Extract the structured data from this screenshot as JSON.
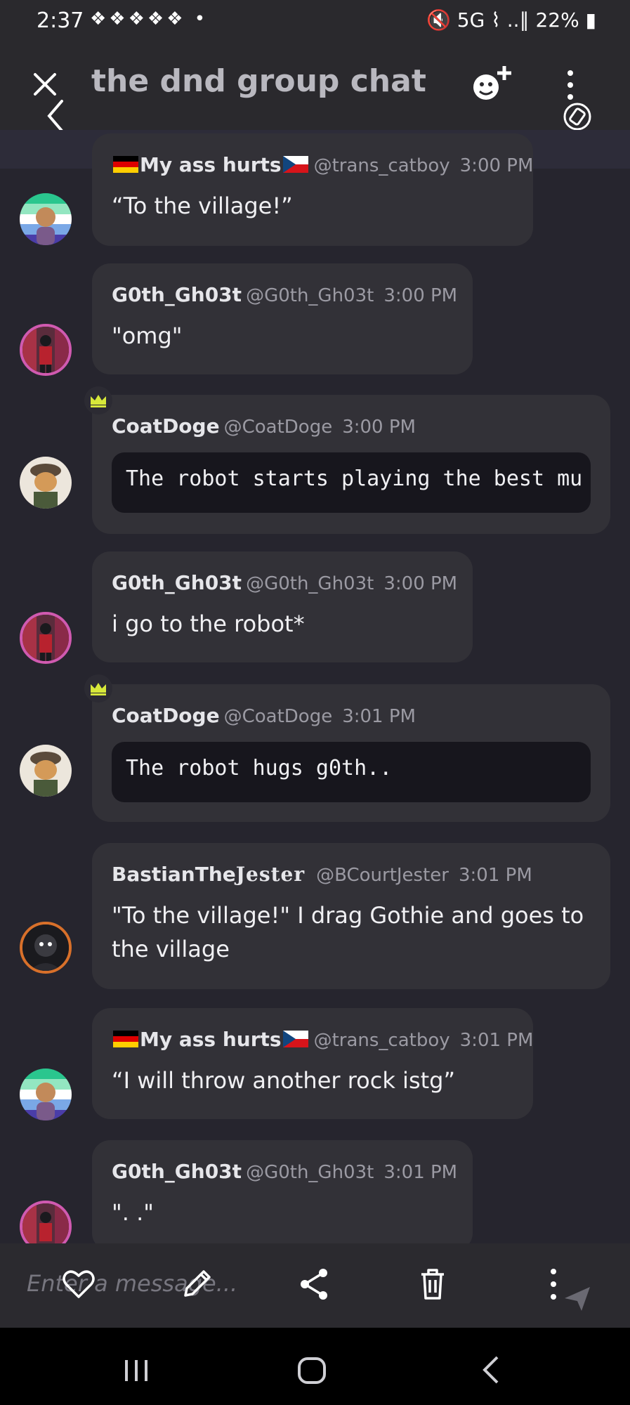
{
  "status_bar": {
    "time": "2:37",
    "notifications": "❖❖❖❖❖ •",
    "right": "🔇 5G ⌇ ..∥ 22% ▮"
  },
  "header": {
    "title": "the dnd group chat",
    "close_icon": "close-icon",
    "back_icon": "chevron-left-icon",
    "emoji_add_icon": "emoji-add-icon",
    "more_icon": "more-vert-icon"
  },
  "messages": [
    {
      "author": "My ass hurts",
      "flag_left": "de",
      "flag_right": "cz",
      "handle": "@trans_catboy",
      "time": "3:00 PM",
      "text": "“To the village!”",
      "avatar": "pride"
    },
    {
      "author": "G0th_Gh03t",
      "handle": "@G0th_Gh03t",
      "time": "3:00 PM",
      "text": "\"omg\"",
      "avatar": "goth"
    },
    {
      "author": "CoatDoge",
      "handle": "@CoatDoge",
      "time": "3:00 PM",
      "code": "The robot starts playing the best mu",
      "avatar": "doge",
      "crown": true
    },
    {
      "author": "G0th_Gh03t",
      "handle": "@G0th_Gh03t",
      "time": "3:00 PM",
      "text": "i go to the robot*",
      "avatar": "goth"
    },
    {
      "author": "CoatDoge",
      "handle": "@CoatDoge",
      "time": "3:01 PM",
      "code": "The robot hugs g0th..",
      "avatar": "doge",
      "crown": true
    },
    {
      "author": "BastianThe",
      "author_glitch": "Jester",
      "handle": "@BCourtJester",
      "time": "3:01 PM",
      "text_line1": "\"To the village!\" I drag Gothie and goes to",
      "text_line2": "the village",
      "avatar": "jester"
    },
    {
      "author": "My ass hurts",
      "flag_left": "de",
      "flag_right": "cz",
      "handle": "@trans_catboy",
      "time": "3:01 PM",
      "text": "“I will throw another rock istg”",
      "avatar": "pride"
    },
    {
      "author": "G0th_Gh03t",
      "handle": "@G0th_Gh03t",
      "time": "3:01 PM",
      "text": "\". .\"",
      "avatar": "goth"
    }
  ],
  "input": {
    "placeholder": "Enter a message...",
    "icons": [
      "heart-icon",
      "edit-icon",
      "share-icon",
      "trash-icon",
      "more-vert-icon"
    ],
    "send_icon": "send-icon"
  },
  "colors": {
    "background": "#26252e",
    "bubble": "#323137",
    "code_block": "#17161d",
    "crown": "#d7e83a"
  }
}
